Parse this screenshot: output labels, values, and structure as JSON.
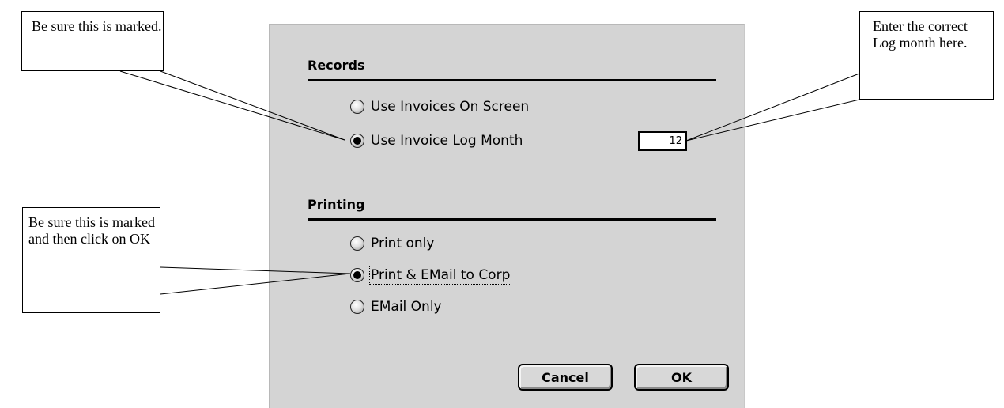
{
  "callouts": {
    "top_left": "Be sure this is marked.",
    "top_right": "Enter the correct Log month here.",
    "bottom_left": "Be sure this is marked and then click on OK"
  },
  "dialog": {
    "records": {
      "title": "Records",
      "options": [
        {
          "label": "Use Invoices On Screen",
          "checked": false
        },
        {
          "label": "Use Invoice Log Month",
          "checked": true
        }
      ],
      "log_month_value": "12"
    },
    "printing": {
      "title": "Printing",
      "options": [
        {
          "label": "Print only",
          "checked": false
        },
        {
          "label": "Print & EMail to Corp",
          "checked": true
        },
        {
          "label": "EMail Only",
          "checked": false
        }
      ]
    },
    "buttons": {
      "cancel": "Cancel",
      "ok": "OK"
    }
  }
}
